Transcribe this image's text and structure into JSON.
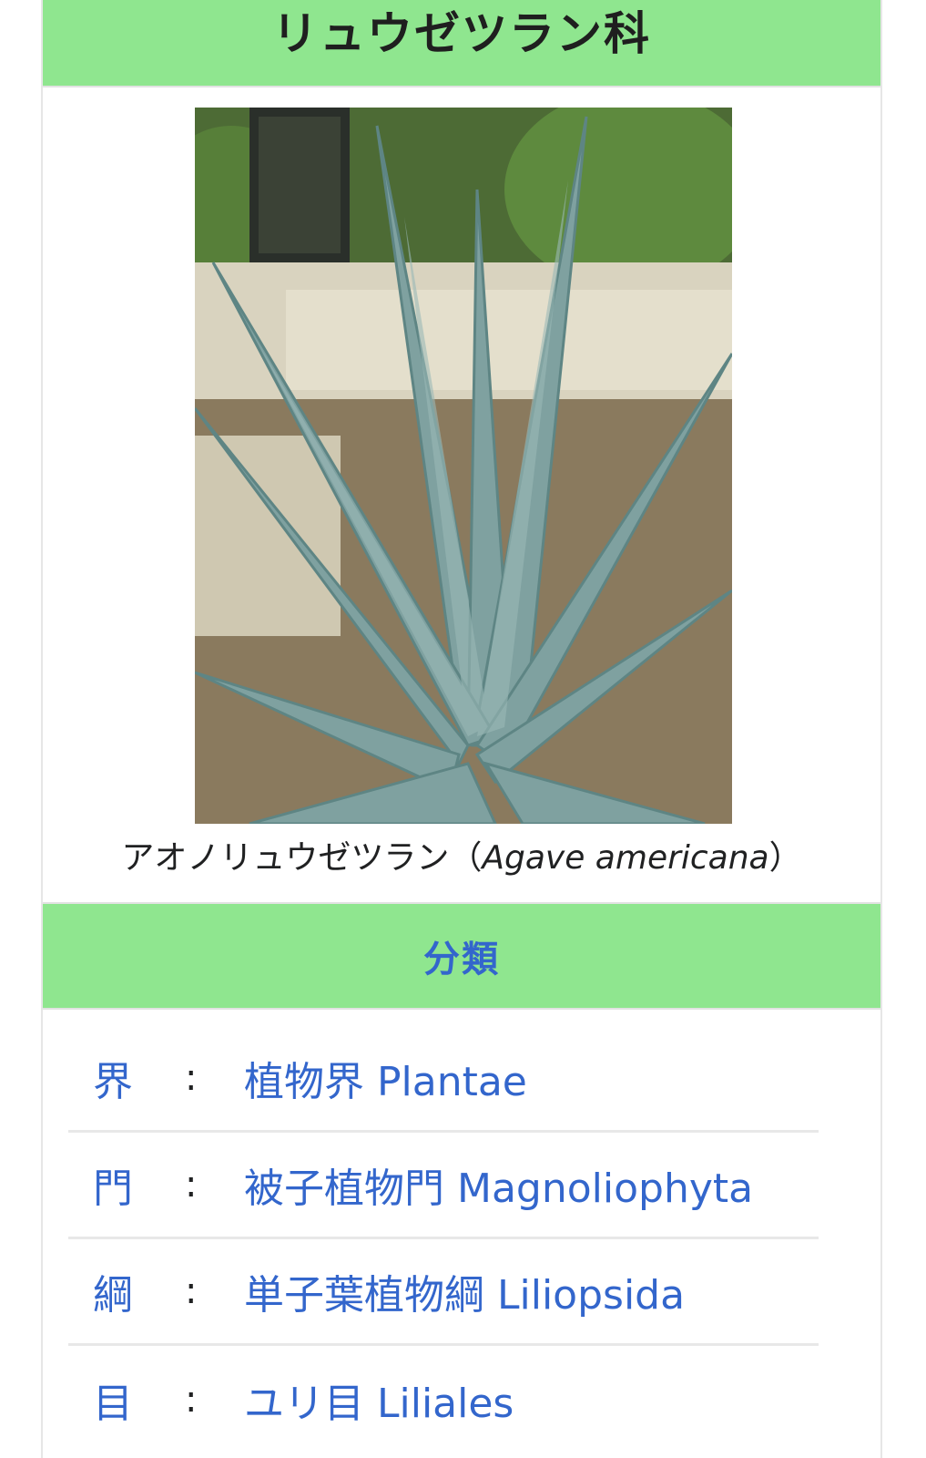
{
  "infobox": {
    "title": "リュウゼツラン科",
    "image": {
      "caption_prefix": "アオノリュウゼツラン（",
      "caption_italic": "Agave americana",
      "caption_suffix": "）"
    },
    "section_header": "分類",
    "taxonomy": [
      {
        "rank": "界",
        "separator": ":",
        "value": "植物界 Plantae"
      },
      {
        "rank": "門",
        "separator": ":",
        "value": "被子植物門 Magnoliophyta"
      },
      {
        "rank": "綱",
        "separator": ":",
        "value": "単子葉植物綱 Liliopsida"
      },
      {
        "rank": "目",
        "separator": ":",
        "value": "ユリ目 Liliales"
      }
    ]
  },
  "colors": {
    "header_bg": "#8fe68f",
    "link": "#3366cc",
    "text": "#202122"
  }
}
